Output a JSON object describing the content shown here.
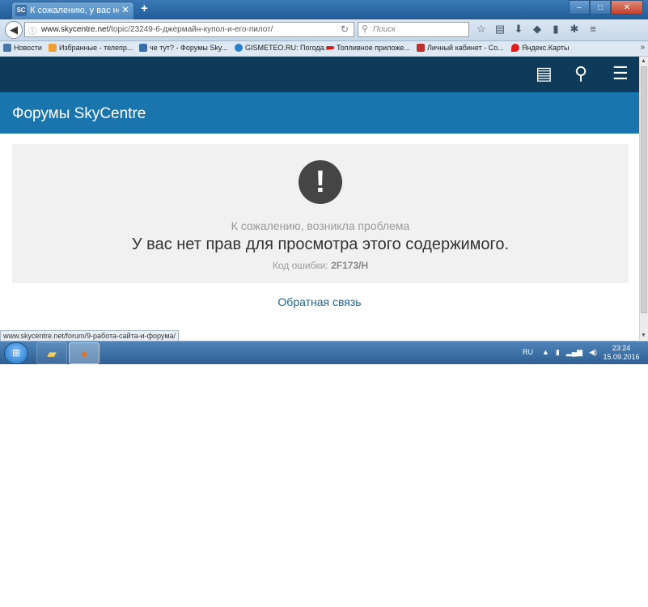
{
  "browser": {
    "tab_title": "К сожалению, у вас нет д...",
    "tab_favicon": "SC",
    "url_domain": "www.skycentre.net",
    "url_path": "/topic/23249-6-джермайн-купол-и-его-пилот/",
    "search_placeholder": "Поиск",
    "status_url": "www.skycentre.net/forum/9-работа-сайта-и-форума/"
  },
  "bookmarks": [
    {
      "label": "Новости",
      "icon": "vk-icon",
      "color": "#4a76a8"
    },
    {
      "label": "Избранные - телепр...",
      "icon": "tv-icon",
      "color": "#f0a030"
    },
    {
      "label": "че тут? - Форумы Sky...",
      "icon": "sc-icon",
      "color": "#3a6ea8"
    },
    {
      "label": "GISMETEO.RU: Погода...",
      "icon": "drop-icon",
      "color": "#2a80c8"
    },
    {
      "label": "Топливное приложе...",
      "icon": "fuel-icon",
      "color": "#d02020"
    },
    {
      "label": "Личный кабинет - Со...",
      "icon": "cabinet-icon",
      "color": "#c03030"
    },
    {
      "label": "Яндекс.Карты",
      "icon": "map-pin-icon",
      "color": "#e02020"
    }
  ],
  "page": {
    "forum_title": "Форумы SkyCentre",
    "error_subtitle": "К сожалению, возникла проблема",
    "error_message": "У вас нет прав для просмотра этого содержимого.",
    "error_code_label": "Код ошибки:",
    "error_code": "2F173/H",
    "feedback_link": "Обратная связь"
  },
  "taskbar": {
    "language": "RU",
    "time": "23:24",
    "date": "15.09.2016"
  }
}
